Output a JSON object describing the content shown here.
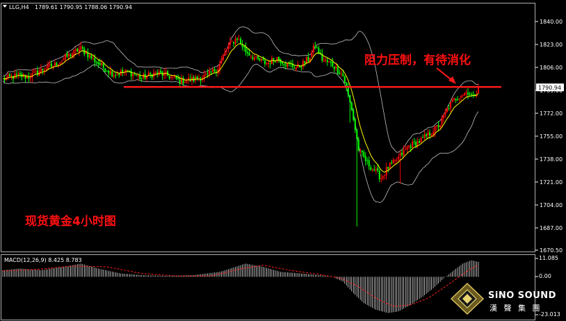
{
  "header": {
    "symbol_info": "LLG,H4",
    "ohlc": "1789.61 1790.95 1788.06 1790.94"
  },
  "annotations": {
    "resistance_note": "阻力压制，有待消化",
    "chart_caption": "现货黄金4小时图"
  },
  "macd_panel": {
    "label": "MACD(12,26,9) 8.425 8.783",
    "scale_top": "11.085",
    "scale_zero": "0.00",
    "scale_bottom": "-23.013"
  },
  "logo": {
    "name_en": "SiNO SOUND",
    "name_cn": "漢 聲 集 團"
  },
  "colors": {
    "background": "#000000",
    "bull": "#ff0000",
    "bear": "#00ff00",
    "ma": "#ffff00",
    "bands": "#c0c0c0",
    "resistance": "#ff0000",
    "macd_hist": "#ffffff",
    "macd_signal": "#ff0000",
    "price_tag_bg": "#ffffff"
  },
  "chart_data": {
    "type": "candlestick",
    "timeframe": "H4",
    "ylim": [
      1670.5,
      1840.0
    ],
    "price_ticks": [
      1840.0,
      1823.0,
      1806.0,
      1789.0,
      1772.0,
      1755.0,
      1738.0,
      1721.0,
      1704.0,
      1687.0,
      1670.5
    ],
    "last_price": 1790.94,
    "resistance_level": 1791.5,
    "anchor_closes": [
      [
        0,
        1797
      ],
      [
        8,
        1800
      ],
      [
        15,
        1799
      ],
      [
        22,
        1804
      ],
      [
        30,
        1808
      ],
      [
        38,
        1815
      ],
      [
        45,
        1820
      ],
      [
        52,
        1812
      ],
      [
        58,
        1806
      ],
      [
        64,
        1801
      ],
      [
        72,
        1803
      ],
      [
        80,
        1798
      ],
      [
        88,
        1802
      ],
      [
        95,
        1800
      ],
      [
        102,
        1796
      ],
      [
        110,
        1797
      ],
      [
        118,
        1800
      ],
      [
        124,
        1806
      ],
      [
        130,
        1822
      ],
      [
        135,
        1828
      ],
      [
        140,
        1818
      ],
      [
        146,
        1812
      ],
      [
        152,
        1809
      ],
      [
        158,
        1813
      ],
      [
        164,
        1808
      ],
      [
        170,
        1806
      ],
      [
        176,
        1812
      ],
      [
        180,
        1822
      ],
      [
        184,
        1812
      ],
      [
        190,
        1808
      ],
      [
        196,
        1800
      ],
      [
        201,
        1775
      ],
      [
        205,
        1745
      ],
      [
        210,
        1735
      ],
      [
        214,
        1730
      ],
      [
        218,
        1724
      ],
      [
        222,
        1732
      ],
      [
        226,
        1736
      ],
      [
        230,
        1742
      ],
      [
        234,
        1748
      ],
      [
        240,
        1751
      ],
      [
        246,
        1757
      ],
      [
        252,
        1764
      ],
      [
        256,
        1775
      ],
      [
        260,
        1782
      ],
      [
        264,
        1786
      ],
      [
        268,
        1788
      ],
      [
        271,
        1784
      ],
      [
        274,
        1790.94
      ]
    ],
    "spikes": [
      [
        200,
        1765
      ],
      [
        204,
        1688
      ],
      [
        229,
        1720
      ]
    ],
    "macd": {
      "ylim": [
        -23.013,
        11.085
      ],
      "histogram": [
        [
          0,
          4
        ],
        [
          10,
          5
        ],
        [
          22,
          4
        ],
        [
          35,
          6
        ],
        [
          45,
          8
        ],
        [
          55,
          5
        ],
        [
          68,
          2
        ],
        [
          80,
          1
        ],
        [
          95,
          0.5
        ],
        [
          110,
          1
        ],
        [
          125,
          3
        ],
        [
          140,
          8
        ],
        [
          150,
          6
        ],
        [
          160,
          3
        ],
        [
          172,
          2
        ],
        [
          182,
          1
        ],
        [
          190,
          0
        ],
        [
          196,
          -3
        ],
        [
          202,
          -10
        ],
        [
          208,
          -16
        ],
        [
          215,
          -20
        ],
        [
          222,
          -22
        ],
        [
          228,
          -21
        ],
        [
          235,
          -17
        ],
        [
          242,
          -12
        ],
        [
          248,
          -7
        ],
        [
          254,
          -1
        ],
        [
          260,
          4
        ],
        [
          265,
          8
        ],
        [
          270,
          10
        ],
        [
          274,
          9
        ]
      ],
      "signal": [
        [
          0,
          3.5
        ],
        [
          20,
          4.5
        ],
        [
          40,
          6.5
        ],
        [
          60,
          6
        ],
        [
          80,
          2
        ],
        [
          100,
          0.5
        ],
        [
          120,
          0.5
        ],
        [
          138,
          5
        ],
        [
          150,
          7
        ],
        [
          165,
          4
        ],
        [
          182,
          1.5
        ],
        [
          195,
          -1
        ],
        [
          205,
          -6
        ],
        [
          215,
          -13
        ],
        [
          225,
          -18
        ],
        [
          235,
          -17
        ],
        [
          245,
          -13
        ],
        [
          255,
          -6
        ],
        [
          263,
          0
        ],
        [
          270,
          5
        ],
        [
          274,
          7
        ]
      ]
    }
  }
}
